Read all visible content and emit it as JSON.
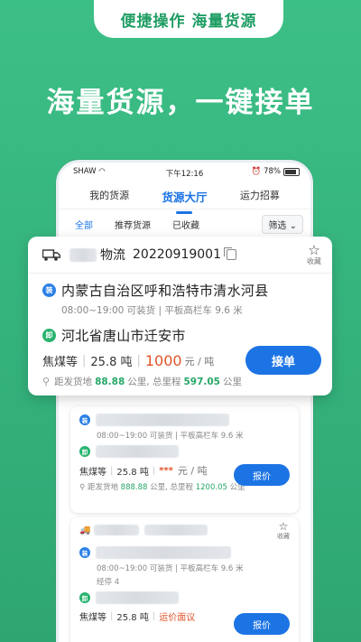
{
  "banner": {
    "pill": "便捷操作 海量货源",
    "headline": "海量货源，一键接单"
  },
  "status_bar": {
    "carrier": "SHAW",
    "time": "下午12:16",
    "battery": "78%"
  },
  "tabs": [
    {
      "label": "我的货源"
    },
    {
      "label": "货源大厅"
    },
    {
      "label": "运力招募"
    }
  ],
  "filters": {
    "all": "全部",
    "recommended": "推荐货源",
    "favorited": "已收藏",
    "screen": "筛选"
  },
  "featured": {
    "company_suffix": "物流",
    "order_id": "20220919001",
    "fav_label": "收藏",
    "load_badge": "装",
    "load_address": "内蒙古自治区呼和浩特市清水河县",
    "load_time": "08:00~19:00 可装货",
    "vehicle": "平板高栏车 9.6 米",
    "unload_badge": "卸",
    "unload_address": "河北省唐山市迁安市",
    "cargo": "焦煤等",
    "weight": "25.8 吨",
    "price": "1000",
    "price_unit": "元 / 吨",
    "accept": "接单",
    "dist_prefix": "距发货地",
    "dist_value": "88.88",
    "dist_unit": "公里,",
    "total_prefix": "总里程",
    "total_value": "597.05",
    "total_unit": "公里"
  },
  "card2": {
    "load_badge": "装",
    "load_time": "08:00~19:00 可装货",
    "vehicle": "平板高栏车 9.6 米",
    "unload_badge": "卸",
    "cargo": "焦煤等",
    "weight": "25.8 吨",
    "price_mask": "***",
    "price_unit": "元 / 吨",
    "button": "报价",
    "dist_prefix": "距发货地",
    "dist_value": "888.88",
    "dist_unit": "公里,",
    "total_prefix": "总里程",
    "total_value": "1200.05",
    "total_unit": "公里"
  },
  "card3": {
    "fav_label": "收藏",
    "load_badge": "装",
    "load_time": "08:00~19:00 可装货",
    "vehicle": "平板高栏车 9.6 米",
    "via": "经停 4",
    "unload_badge": "卸",
    "cargo": "焦煤等",
    "weight": "25.8 吨",
    "negotiable": "运价面议",
    "button": "报价"
  },
  "colors": {
    "brand_green": "#34b27c",
    "primary_blue": "#1c74e4",
    "price_red": "#e0542a"
  }
}
